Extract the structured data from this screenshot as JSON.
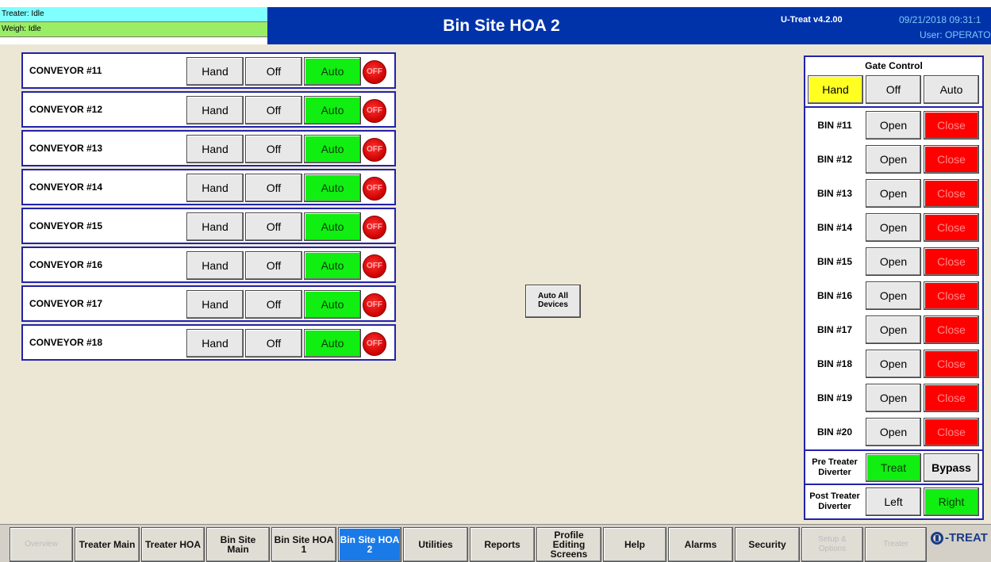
{
  "header": {
    "treater_status": "Treater: Idle",
    "weigh_status": "Weigh: Idle",
    "title": "Bin Site HOA 2",
    "version": "U-Treat v4.2.00",
    "datetime": "09/21/2018 09:31:1",
    "user": "User: OPERATOR"
  },
  "conveyors": [
    {
      "label": "CONVEYOR #11",
      "hand": "Hand",
      "off": "Off",
      "auto": "Auto",
      "indicator": "OFF"
    },
    {
      "label": "CONVEYOR #12",
      "hand": "Hand",
      "off": "Off",
      "auto": "Auto",
      "indicator": "OFF"
    },
    {
      "label": "CONVEYOR #13",
      "hand": "Hand",
      "off": "Off",
      "auto": "Auto",
      "indicator": "OFF"
    },
    {
      "label": "CONVEYOR #14",
      "hand": "Hand",
      "off": "Off",
      "auto": "Auto",
      "indicator": "OFF"
    },
    {
      "label": "CONVEYOR #15",
      "hand": "Hand",
      "off": "Off",
      "auto": "Auto",
      "indicator": "OFF"
    },
    {
      "label": "CONVEYOR #16",
      "hand": "Hand",
      "off": "Off",
      "auto": "Auto",
      "indicator": "OFF"
    },
    {
      "label": "CONVEYOR #17",
      "hand": "Hand",
      "off": "Off",
      "auto": "Auto",
      "indicator": "OFF"
    },
    {
      "label": "CONVEYOR #18",
      "hand": "Hand",
      "off": "Off",
      "auto": "Auto",
      "indicator": "OFF"
    }
  ],
  "auto_all": {
    "line1": "Auto All",
    "line2": "Devices"
  },
  "gate": {
    "title": "Gate Control",
    "hand": "Hand",
    "off": "Off",
    "auto": "Auto",
    "selected_mode": "Hand",
    "bins": [
      {
        "label": "BIN #11",
        "open": "Open",
        "close": "Close"
      },
      {
        "label": "BIN #12",
        "open": "Open",
        "close": "Close"
      },
      {
        "label": "BIN #13",
        "open": "Open",
        "close": "Close"
      },
      {
        "label": "BIN #14",
        "open": "Open",
        "close": "Close"
      },
      {
        "label": "BIN #15",
        "open": "Open",
        "close": "Close"
      },
      {
        "label": "BIN #16",
        "open": "Open",
        "close": "Close"
      },
      {
        "label": "BIN #17",
        "open": "Open",
        "close": "Close"
      },
      {
        "label": "BIN #18",
        "open": "Open",
        "close": "Close"
      },
      {
        "label": "BIN #19",
        "open": "Open",
        "close": "Close"
      },
      {
        "label": "BIN #20",
        "open": "Open",
        "close": "Close"
      }
    ],
    "pre_treater": {
      "line1": "Pre Treater",
      "line2": "Diverter",
      "treat": "Treat",
      "bypass": "Bypass",
      "selected": "Treat"
    },
    "post_treater": {
      "line1": "Post Treater",
      "line2": "Diverter",
      "left": "Left",
      "right": "Right",
      "selected": "Right"
    }
  },
  "nav": [
    {
      "line1": "Overview",
      "line2": "",
      "state": "disabled"
    },
    {
      "line1": "Treater Main",
      "line2": "",
      "state": "normal"
    },
    {
      "line1": "Treater HOA",
      "line2": "",
      "state": "normal"
    },
    {
      "line1": "Bin Site",
      "line2": "Main",
      "state": "normal"
    },
    {
      "line1": "Bin Site HOA",
      "line2": "1",
      "state": "normal"
    },
    {
      "line1": "Bin Site HOA",
      "line2": "2",
      "state": "active"
    },
    {
      "line1": "Utilities",
      "line2": "",
      "state": "normal"
    },
    {
      "line1": "Reports",
      "line2": "",
      "state": "normal"
    },
    {
      "line1": "Profile",
      "line2": "Editing",
      "line3": "Screens",
      "state": "normal"
    },
    {
      "line1": "Help",
      "line2": "",
      "state": "normal"
    },
    {
      "line1": "Alarms",
      "line2": "",
      "state": "normal"
    },
    {
      "line1": "Security",
      "line2": "",
      "state": "normal"
    },
    {
      "line1": "Setup &",
      "line2": "Options",
      "state": "disabled"
    },
    {
      "line1": "Treater",
      "line2": "",
      "state": "disabled"
    }
  ],
  "logo": {
    "icon": "u-treat-logo-icon",
    "text": "-TREAT"
  },
  "colors": {
    "header_bar": "#0033aa",
    "auto_active": "#11ee11",
    "close_red": "#ff0000",
    "hand_yellow": "#ffff22",
    "active_tab": "#1a7ae8"
  }
}
